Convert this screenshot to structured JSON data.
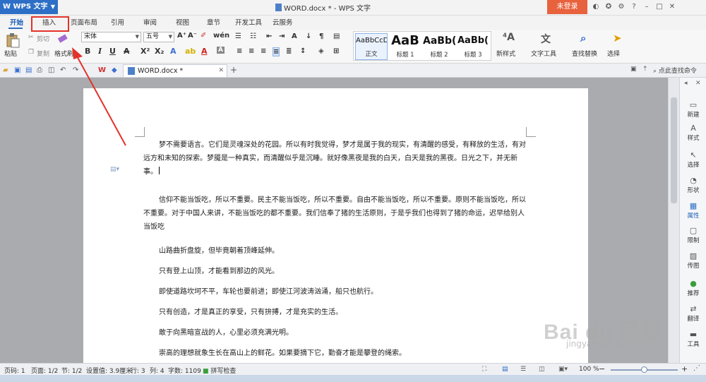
{
  "app": {
    "name": "WPS 文字",
    "window_title": "WORD.docx * - WPS 文字",
    "login": "未登录"
  },
  "tabs": [
    "开始",
    "插入",
    "页面布局",
    "引用",
    "审阅",
    "视图",
    "章节",
    "开发工具",
    "云服务"
  ],
  "ribbon": {
    "paste": "粘贴",
    "cut": "剪切",
    "copy": "复制",
    "format_painter": "格式刷",
    "font_name": "宋体",
    "font_size": "五号",
    "styles": [
      {
        "preview": "AaBbCcD",
        "label": "正文"
      },
      {
        "preview": "AaB",
        "label": "标题 1"
      },
      {
        "preview": "AaBb(",
        "label": "标题 2"
      },
      {
        "preview": "AaBb(",
        "label": "标题 3"
      }
    ],
    "new_style": "新样式",
    "text_tools": "文字工具",
    "find_replace": "查找替换",
    "select": "选择"
  },
  "doc_tab": {
    "name": "WORD.docx *"
  },
  "quickbar": {
    "search": "点此查找命令"
  },
  "document": {
    "para1": "梦不需要语言。它们是灵魂深处的花园。所以有时我觉得，梦才是属于我的现实，有清醒的感受，有释放的生活，有对远方和未知的探索。梦魇是一种真实，而清醒似乎是沉睡。就好像黑夜是我的白天，白天是我的黑夜。日光之下，并无新事。",
    "para2": "信仰不能当饭吃，所以不重要。民主不能当饭吃，所以不重要。自由不能当饭吃，所以不重要。原则不能当饭吃，所以不重要。对于中国人来讲，不能当饭吃的都不重要。我们信奉了猪的生活原则，于是乎我们也得到了猪的命运，迟早给别人当饭吃",
    "lines": [
      "山路曲折盘旋，但毕竟朝着顶峰延伸。",
      "只有登上山顶，才能看到那边的风光。",
      "即使道路坎坷不平，车轮也要前进；即使江河波涛汹涌，船只也航行。",
      "只有创造，才是真正的享受，只有拚搏，才是充实的生活。",
      "敢于向黑暗宣战的人，心里必须充满光明。",
      "崇高的理想就象生长在高山上的鲜花。如果要摘下它，勤奋才能是攀登的绳索。"
    ]
  },
  "sidepanel": [
    "新建",
    "样式",
    "选择",
    "形状",
    "属性",
    "限制",
    "传图",
    "推荐",
    "翻译",
    "工具"
  ],
  "status": {
    "page_num": "页码: 1",
    "pages": "页面: 1/2",
    "section": "节: 1/2",
    "setting": "设置值: 3.9厘米",
    "row": "行: 3",
    "col": "列: 4",
    "chars": "字数: 1109",
    "spell": "拼写检查",
    "zoom": "100 %",
    "zoom_fraction": 0.5
  },
  "watermark": {
    "brand": "Bai du 经验",
    "url": "jingyan.baidu.com"
  },
  "colors": {
    "accent": "#2d6fc6",
    "login": "#e8623d",
    "annotation": "#e3322a"
  }
}
